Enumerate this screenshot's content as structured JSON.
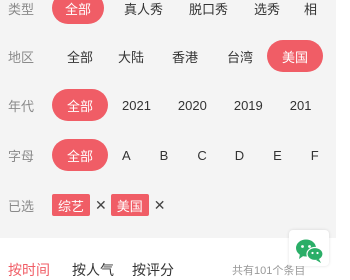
{
  "filters": {
    "type": {
      "label": "类型",
      "options": [
        "全部",
        "真人秀",
        "脱口秀",
        "选秀",
        "相"
      ]
    },
    "region": {
      "label": "地区",
      "options": [
        "全部",
        "大陆",
        "香港",
        "台湾",
        "美国"
      ]
    },
    "year": {
      "label": "年代",
      "options": [
        "全部",
        "2021",
        "2020",
        "2019",
        "201"
      ]
    },
    "letter": {
      "label": "字母",
      "options": [
        "全部",
        "A",
        "B",
        "C",
        "D",
        "E",
        "F"
      ]
    },
    "selected": {
      "label": "已选",
      "tags": [
        "综艺",
        "美国"
      ],
      "remove_symbol": "✕"
    }
  },
  "sort": {
    "by_time": "按时间",
    "by_popularity": "按人气",
    "by_rating": "按评分",
    "count_text": "共有101个条目"
  },
  "colors": {
    "accent": "#f05d66",
    "wechat_green": "#2aae67"
  },
  "icons": {
    "wechat": "wechat-icon"
  }
}
